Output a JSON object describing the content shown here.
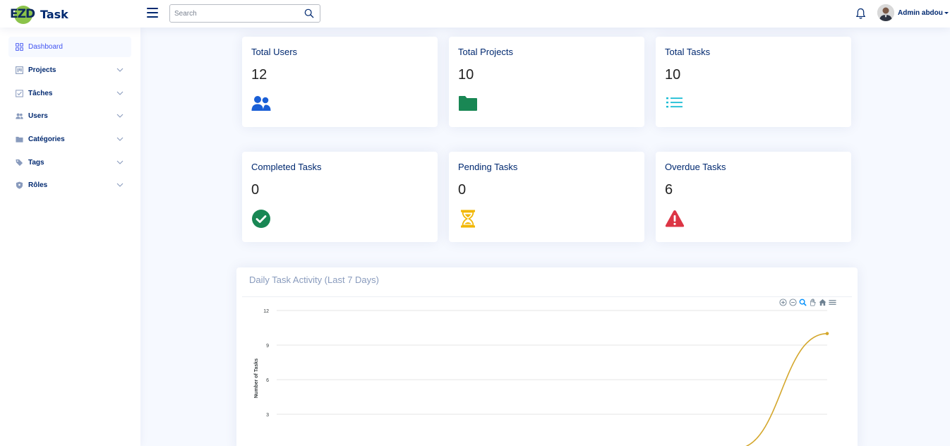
{
  "header": {
    "logo_mark": "EZD",
    "logo_text": "Task",
    "search_placeholder": "Search",
    "user_name": "Admin abdou"
  },
  "sidebar": {
    "items": [
      {
        "label": "Dashboard",
        "icon": "grid-icon",
        "active": true
      },
      {
        "label": "Projects",
        "icon": "project-icon"
      },
      {
        "label": "Tâches",
        "icon": "task-check-icon"
      },
      {
        "label": "Users",
        "icon": "users-icon"
      },
      {
        "label": "Catégories",
        "icon": "folder-icon"
      },
      {
        "label": "Tags",
        "icon": "tags-icon"
      },
      {
        "label": "Rôles",
        "icon": "shield-icon"
      }
    ]
  },
  "cards": [
    {
      "title": "Total Users",
      "value": "12",
      "icon": "users-icon",
      "color": "#1a5fd6"
    },
    {
      "title": "Total Projects",
      "value": "10",
      "icon": "folder-icon",
      "color": "#198754"
    },
    {
      "title": "Total Tasks",
      "value": "10",
      "icon": "list-icon",
      "color": "#17bcd4"
    },
    {
      "title": "Completed Tasks",
      "value": "0",
      "icon": "check-circle-icon",
      "color": "#198754"
    },
    {
      "title": "Pending Tasks",
      "value": "0",
      "icon": "hourglass-icon",
      "color": "#f2b705"
    },
    {
      "title": "Overdue Tasks",
      "value": "6",
      "icon": "warning-icon",
      "color": "#dc3545"
    }
  ],
  "chart": {
    "title": "Daily Task Activity (Last 7 Days)"
  },
  "chart_data": {
    "type": "line",
    "ylabel": "Number of Tasks",
    "ylim": [
      0,
      12
    ],
    "yticks": [
      3,
      6,
      9,
      12
    ],
    "grid": true,
    "series": [
      {
        "color": "#d4a72c",
        "x": [
          0,
          1,
          2,
          3,
          4,
          5,
          6
        ],
        "values": [
          0,
          0,
          0,
          0,
          0,
          0,
          10
        ]
      }
    ]
  }
}
